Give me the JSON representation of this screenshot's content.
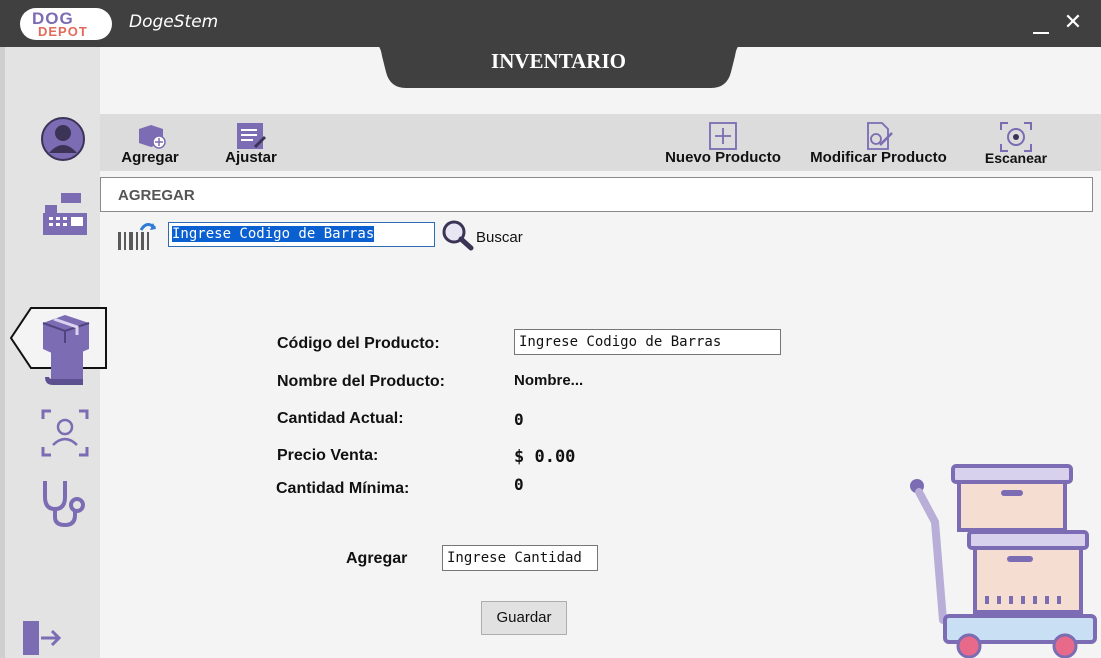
{
  "window": {
    "app_title": "DogeStem",
    "logo_line1": "DOG",
    "logo_line2": "DEPOT",
    "minimize_icon": "minimize-icon",
    "close_glyph": "✕"
  },
  "header": {
    "title": "INVENTARIO"
  },
  "sidebar": {
    "items": [
      {
        "icon": "user-icon"
      },
      {
        "icon": "cash-register-icon"
      },
      {
        "icon": "box-icon",
        "active": true
      },
      {
        "icon": "book-icon"
      },
      {
        "icon": "face-scan-icon"
      },
      {
        "icon": "stethoscope-icon"
      },
      {
        "icon": "logout-icon"
      }
    ]
  },
  "toolbar": {
    "agregar_label": "Agregar",
    "ajustar_label": "Ajustar",
    "nuevo_label": "Nuevo Producto",
    "modificar_label": "Modificar Producto",
    "escanear_label": "Escanear"
  },
  "section": {
    "title": "AGREGAR"
  },
  "search": {
    "input_value": "Ingrese Codigo de Barras",
    "button_label": "Buscar"
  },
  "form": {
    "codigo_label": "Código del Producto:",
    "codigo_value": "Ingrese Codigo de Barras",
    "nombre_label": "Nombre del Producto:",
    "nombre_value": "Nombre...",
    "cantidad_actual_label": "Cantidad Actual:",
    "cantidad_actual_value": "0",
    "precio_label": "Precio Venta:",
    "precio_value": "$ 0.00",
    "cantidad_minima_label": "Cantidad Mínima:",
    "cantidad_minima_value": "0",
    "agregar_label": "Agregar",
    "cantidad_value": "Ingrese Cantidad",
    "guardar_label": "Guardar"
  },
  "colors": {
    "titlebar": "#404040",
    "accent_purple": "#7b6cb3",
    "sidebar_bg": "#e3e3e3",
    "toolbar_bg": "#dcdcdc"
  }
}
